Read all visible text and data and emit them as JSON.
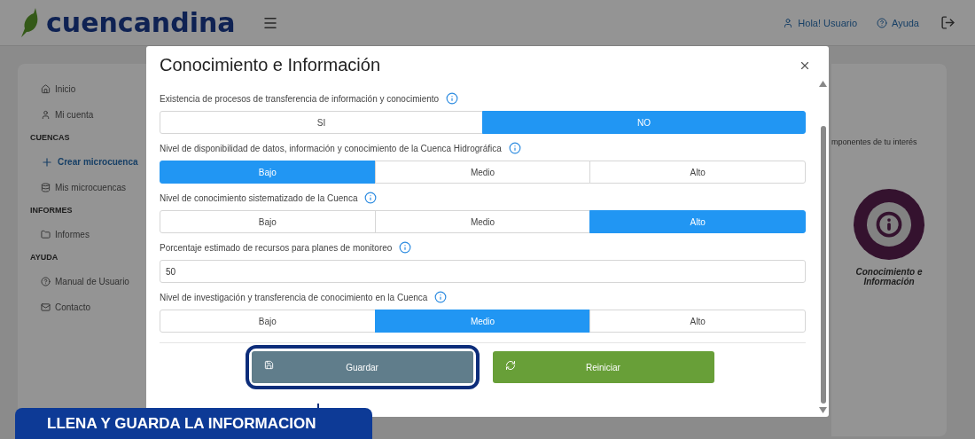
{
  "header": {
    "logo": "cuencandina",
    "user": "Hola! Usuario",
    "help": "Ayuda"
  },
  "sidebar": {
    "sections": [
      {
        "items": [
          {
            "label": "Inicio",
            "selected": false
          },
          {
            "label": "Mi cuenta",
            "selected": false
          }
        ]
      },
      {
        "title": "CUENCAS",
        "items": [
          {
            "label": "Crear microcuenca",
            "selected": true
          },
          {
            "label": "Mis microcuencas",
            "selected": false
          }
        ]
      },
      {
        "title": "INFORMES",
        "items": [
          {
            "label": "Informes",
            "selected": false
          }
        ]
      },
      {
        "title": "AYUDA",
        "items": [
          {
            "label": "Manual de Usuario",
            "selected": false
          },
          {
            "label": "Contacto",
            "selected": false
          }
        ]
      }
    ]
  },
  "content": {
    "text": "mponentes de tu interés",
    "module_label": "Conocimiento e Información"
  },
  "modal": {
    "title": "Conocimiento e Información",
    "questions": [
      {
        "kind": "choice",
        "label": "Existencia de procesos de transferencia de información y conocimiento",
        "options": [
          {
            "label": "SI",
            "selected": false
          },
          {
            "label": "NO",
            "selected": true
          }
        ]
      },
      {
        "kind": "choice",
        "label": "Nivel de disponibilidad de datos, información y conocimiento de la Cuenca Hidrográfica",
        "options": [
          {
            "label": "Bajo",
            "selected": true
          },
          {
            "label": "Medio",
            "selected": false
          },
          {
            "label": "Alto",
            "selected": false
          }
        ]
      },
      {
        "kind": "choice",
        "label": "Nivel de conocimiento sistematizado de la Cuenca",
        "options": [
          {
            "label": "Bajo",
            "selected": false
          },
          {
            "label": "Medio",
            "selected": false
          },
          {
            "label": "Alto",
            "selected": true
          }
        ]
      },
      {
        "kind": "number",
        "label": "Porcentaje estimado de recursos para planes de monitoreo",
        "value": "50"
      },
      {
        "kind": "choice",
        "label": "Nivel de investigación y transferencia de conocimiento en la Cuenca",
        "options": [
          {
            "label": "Bajo",
            "selected": false
          },
          {
            "label": "Medio",
            "selected": true
          },
          {
            "label": "Alto",
            "selected": false
          }
        ]
      }
    ],
    "buttons": [
      {
        "kind": "save",
        "label": "Guardar",
        "highlighted": true
      },
      {
        "kind": "reset",
        "label": "Reiniciar",
        "highlighted": false
      }
    ]
  },
  "banner": "LLENA Y GUARDA LA INFORMACION"
}
